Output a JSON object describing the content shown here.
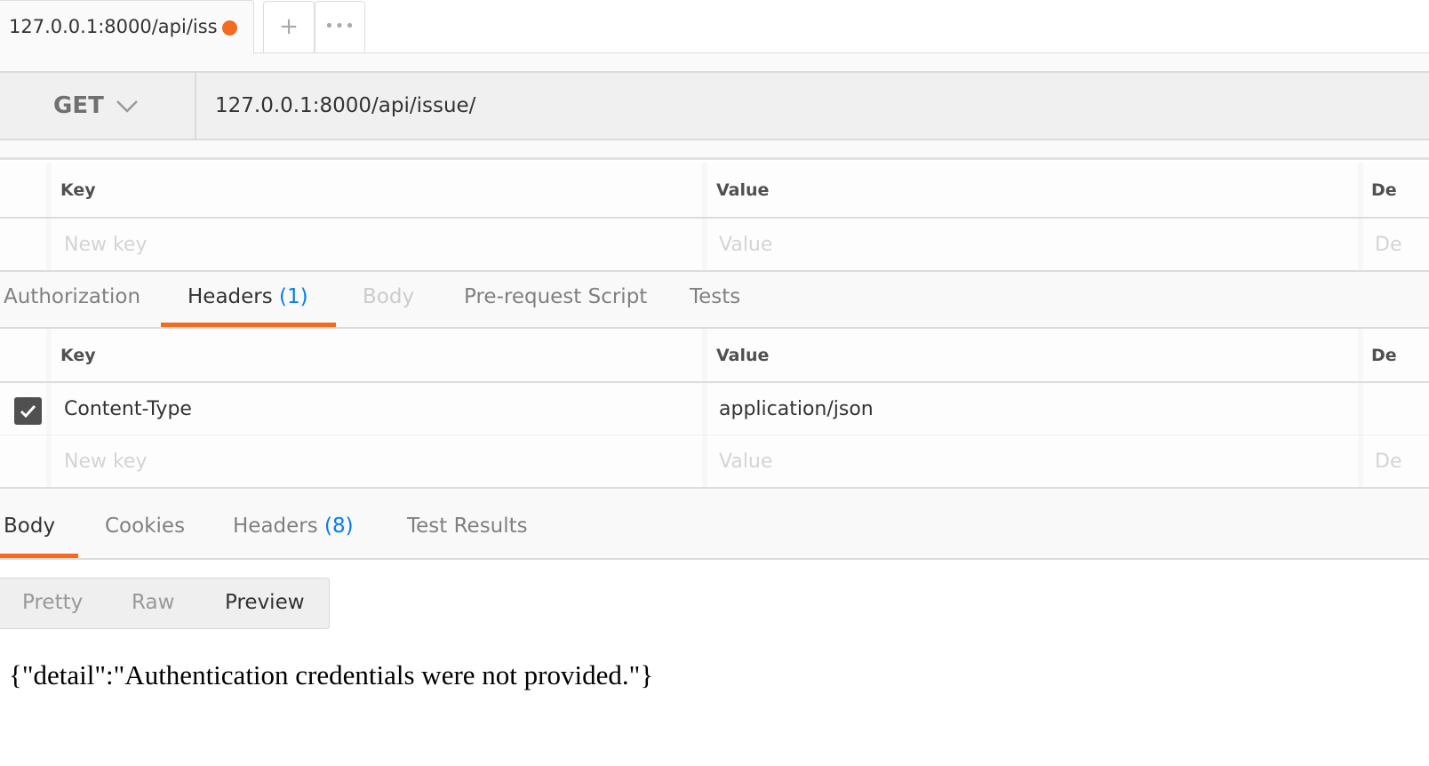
{
  "tabs": {
    "active_label": "127.0.0.1:8000/api/iss",
    "unsaved_color": "#f26b21",
    "new_tab": "+",
    "more": "•••"
  },
  "request": {
    "method": "GET",
    "url": "127.0.0.1:8000/api/issue/"
  },
  "params_table": {
    "headers": [
      "Key",
      "Value",
      "De"
    ],
    "placeholders": [
      "New key",
      "Value",
      "De"
    ]
  },
  "request_tabs": [
    {
      "label": "Authorization"
    },
    {
      "label": "Headers",
      "count": "(1)",
      "active": true
    },
    {
      "label": "Body",
      "disabled": true
    },
    {
      "label": "Pre-request Script"
    },
    {
      "label": "Tests"
    }
  ],
  "headers_table": {
    "headers": [
      "Key",
      "Value",
      "De"
    ],
    "rows": [
      {
        "checked": true,
        "key": "Content-Type",
        "value": "application/json"
      }
    ],
    "placeholders": [
      "New key",
      "Value",
      "De"
    ]
  },
  "response_tabs": [
    {
      "label": "Body",
      "active": true
    },
    {
      "label": "Cookies"
    },
    {
      "label": "Headers",
      "count": "(8)"
    },
    {
      "label": "Test Results"
    }
  ],
  "view_modes": [
    "Pretty",
    "Raw",
    "Preview"
  ],
  "response_body": "{\"detail\":\"Authentication credentials were not provided.\"}",
  "accent": "#f26b21",
  "link": "#097bed"
}
